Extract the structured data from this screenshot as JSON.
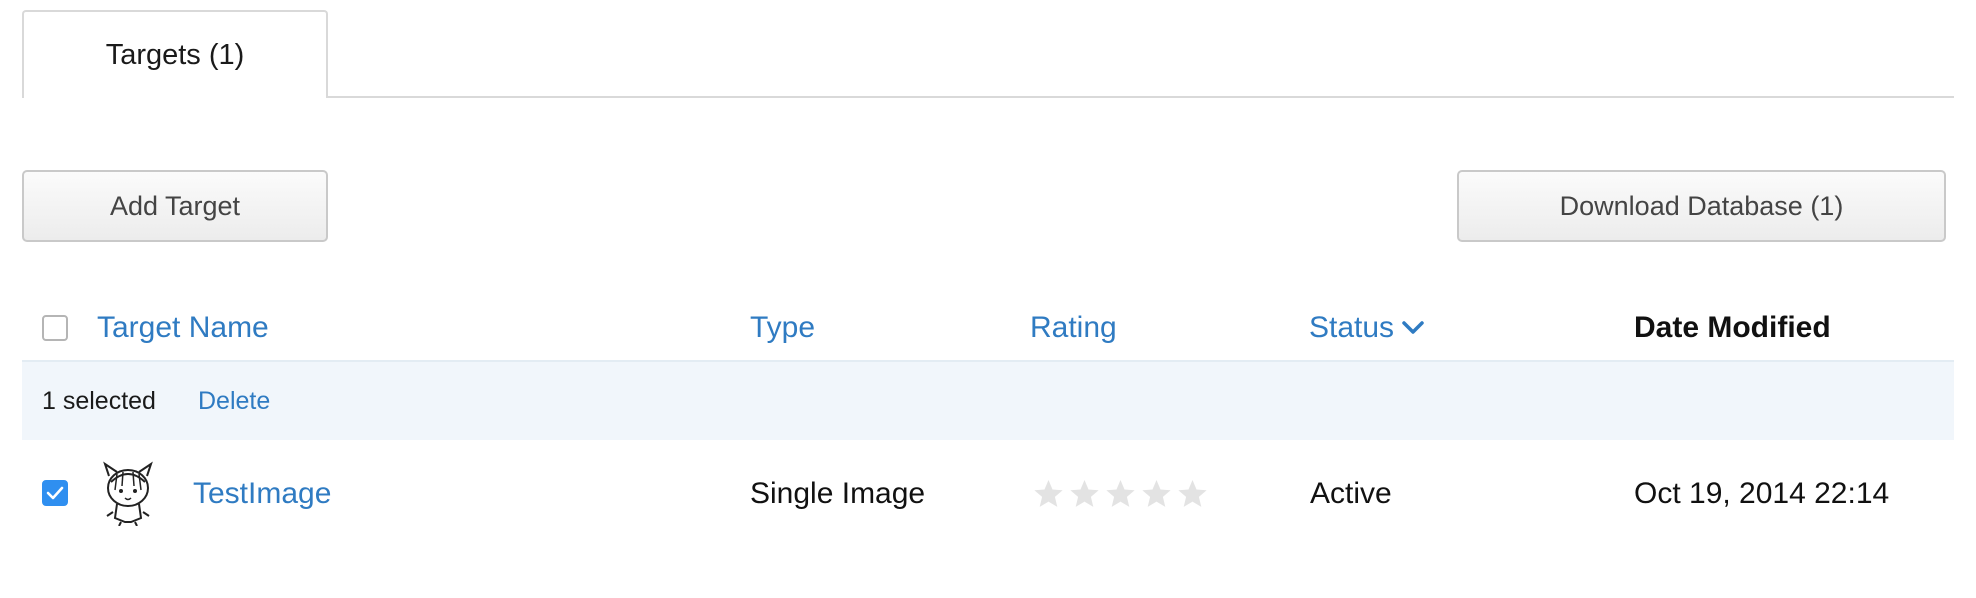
{
  "tabs": [
    {
      "label": "Targets (1)"
    }
  ],
  "toolbar": {
    "add_label": "Add Target",
    "download_label": "Download Database (1)"
  },
  "table": {
    "columns": {
      "name": "Target Name",
      "type": "Type",
      "rating": "Rating",
      "status": "Status",
      "date": "Date Modified"
    },
    "selection": {
      "count_text": "1 selected",
      "delete_label": "Delete"
    },
    "rows": [
      {
        "name": "TestImage",
        "type": "Single Image",
        "rating_stars": 0,
        "rating_max": 5,
        "status": "Active",
        "date": "Oct 19, 2014 22:14",
        "checked": true
      }
    ]
  },
  "colors": {
    "link": "#2f7bc2",
    "checkbox_checked": "#2f8ff0",
    "star_empty": "#e3e3e3",
    "selection_bar": "#f1f6fb"
  },
  "icons": {
    "sort": "chevron-down-icon",
    "thumbnail": "target-thumbnail"
  }
}
